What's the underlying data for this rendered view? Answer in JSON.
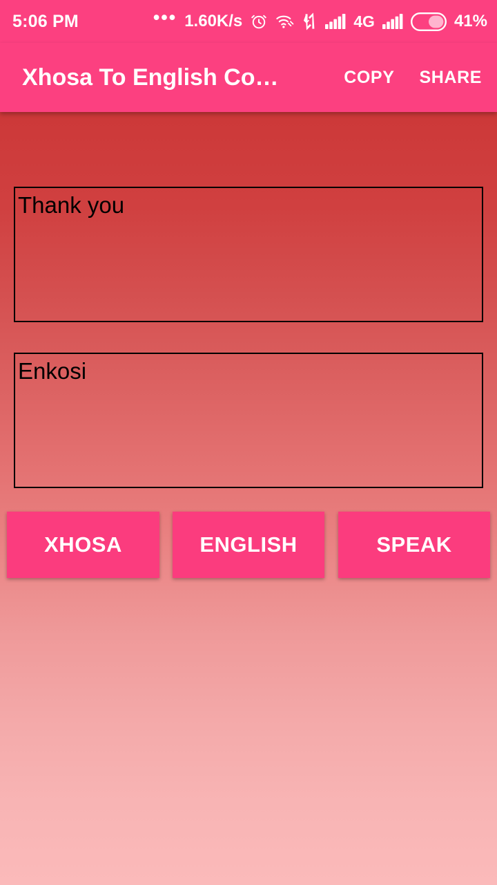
{
  "status_bar": {
    "time": "5:06 PM",
    "overflow_dots": "•••",
    "network_speed": "1.60K/s",
    "network_type": "4G",
    "battery_percent": "41%",
    "icons": [
      "alarm-icon",
      "wifi-icon",
      "data-transfer-icon",
      "signal-bars-icon",
      "signal-bars-icon-2",
      "battery-icon"
    ],
    "background_color": "#fc4080",
    "text_color": "#ffffff"
  },
  "app_bar": {
    "title": "Xhosa To English Co…",
    "copy_label": "COPY",
    "share_label": "SHARE",
    "background_color": "#fc4080"
  },
  "main": {
    "source_text": "Thank you",
    "source_placeholder": "",
    "target_text": "Enkosi",
    "target_placeholder": "",
    "background_gradient_from": "#c93434",
    "background_gradient_to": "#fbbaba"
  },
  "buttons": {
    "xhosa_label": "XHOSA",
    "english_label": "ENGLISH",
    "speak_label": "SPEAK",
    "color": "#fb3c7e",
    "text_color": "#ffffff"
  }
}
